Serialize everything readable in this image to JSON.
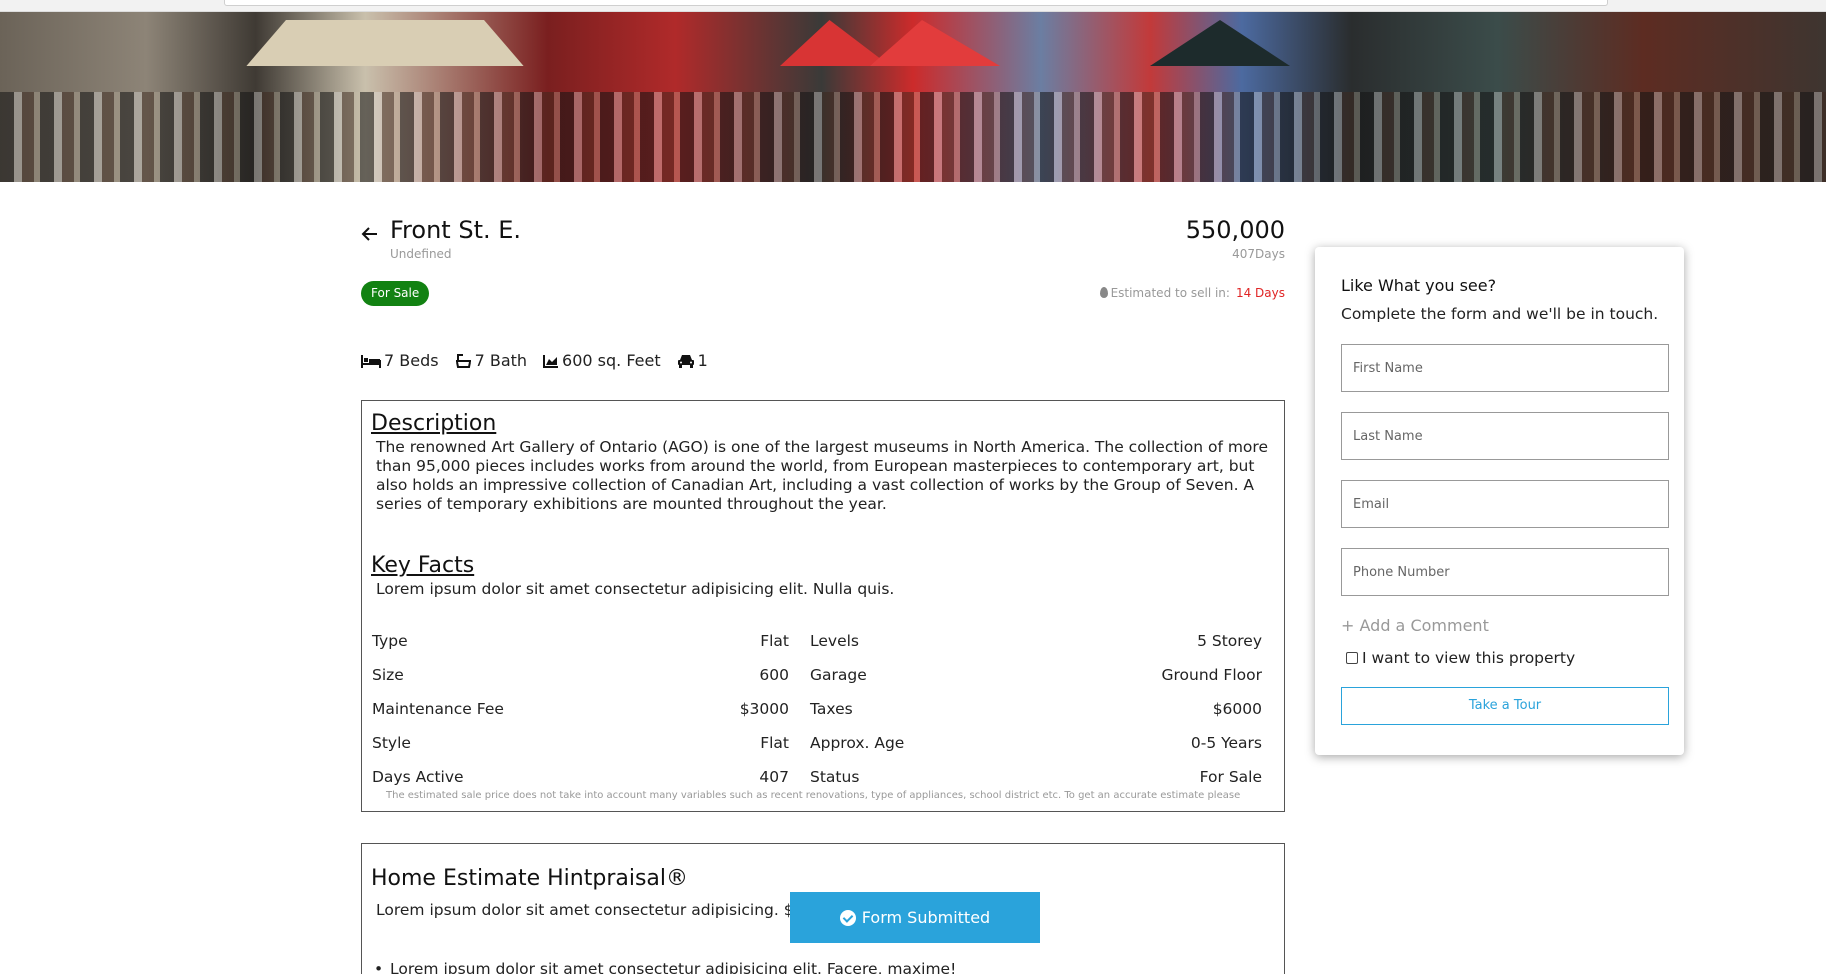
{
  "listing": {
    "title": "Front St. E.",
    "subtitle": "Undefined",
    "price": "550,000",
    "days_label": "407Days",
    "status_badge": "For Sale",
    "estimate_label": "Estimated to sell in:",
    "estimate_value": "14 Days"
  },
  "features": {
    "beds": "7 Beds",
    "baths": "7 Bath",
    "area": "600 sq. Feet",
    "parking": "1"
  },
  "description": {
    "heading": "Description",
    "text": "The renowned Art Gallery of Ontario (AGO) is one of the largest museums in North America. The collection of more than 95,000 pieces includes works from around the world, from European masterpieces to contemporary art, but also holds an impressive collection of Canadian Art, including a vast collection of works by the Group of Seven. A series of temporary exhibitions are mounted throughout the year."
  },
  "key_facts": {
    "heading": "Key Facts",
    "text": "Lorem ipsum dolor sit amet consectetur adipisicing elit. Nulla quis.",
    "rows": [
      {
        "label": "Type",
        "value": "Flat",
        "label2": "Levels",
        "value2": "5 Storey"
      },
      {
        "label": "Size",
        "value": "600",
        "label2": "Garage",
        "value2": "Ground Floor"
      },
      {
        "label": "Maintenance Fee",
        "value": "$3000",
        "label2": "Taxes",
        "value2": "$6000"
      },
      {
        "label": "Style",
        "value": "Flat",
        "label2": "Approx. Age",
        "value2": "0-5 Years"
      },
      {
        "label": "Days Active",
        "value": "407",
        "label2": "Status",
        "value2": "For Sale"
      }
    ],
    "disclaimer": "The estimated sale price does not take into account many variables such as recent renovations, type of appliances, school district etc. To get an accurate estimate please"
  },
  "estimate": {
    "heading": "Home Estimate Hintpraisal®",
    "text": "Lorem ipsum dolor sit amet consectetur adipisicing. $1,1",
    "bullet": "Lorem ipsum dolor sit amet consectetur adipisicing elit. Facere, maxime!"
  },
  "form": {
    "question": "Like What you see?",
    "subtitle": "Complete the form and we'll be in touch.",
    "first_name_placeholder": "First Name",
    "last_name_placeholder": "Last Name",
    "email_placeholder": "Email",
    "phone_placeholder": "Phone Number",
    "add_comment": "+ Add a Comment",
    "checkbox_label": "I want to view this property",
    "tour_button": "Take a Tour"
  },
  "toast": {
    "text": "Form Submitted"
  },
  "colors": {
    "badge_green": "#128212",
    "accent_blue": "#2aa3db",
    "estimate_red": "#e02424"
  }
}
